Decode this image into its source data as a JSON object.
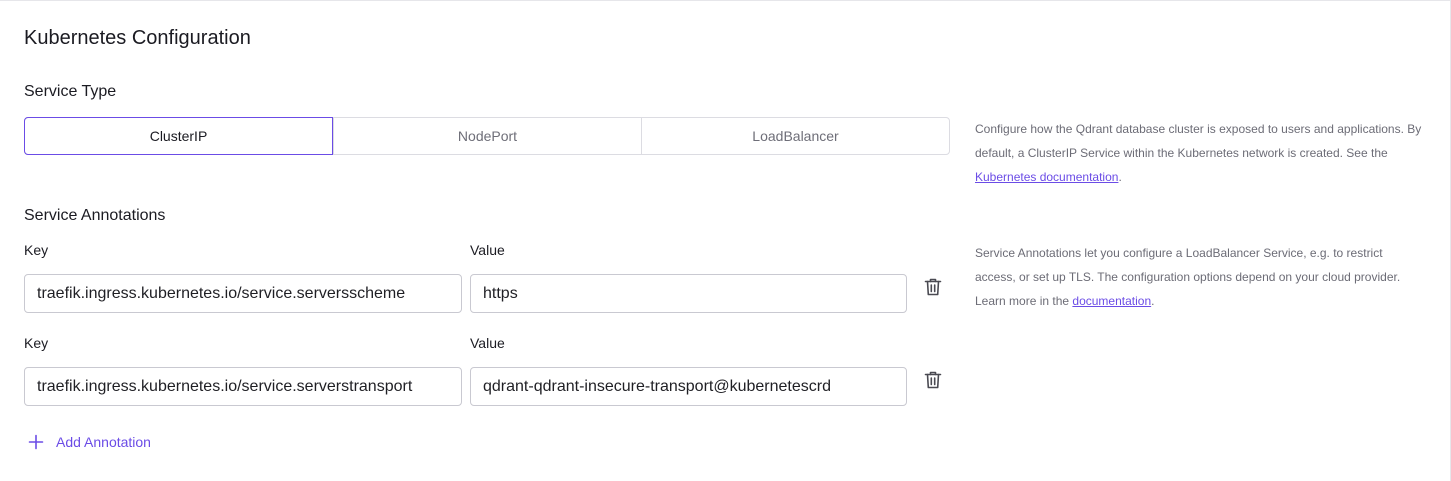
{
  "title": "Kubernetes Configuration",
  "service_type": {
    "label": "Service Type",
    "options": [
      {
        "label": "ClusterIP",
        "active": true
      },
      {
        "label": "NodePort",
        "active": false
      },
      {
        "label": "LoadBalancer",
        "active": false
      }
    ],
    "help": {
      "text_before": "Configure how the Qdrant database cluster is exposed to users and applications. By default, a ClusterIP Service within the Kubernetes network is created. See the ",
      "link": "Kubernetes documentation",
      "text_after": "."
    }
  },
  "annotations": {
    "label": "Service Annotations",
    "rows": [
      {
        "key_label": "Key",
        "value_label": "Value",
        "key": "traefik.ingress.kubernetes.io/service.serversscheme",
        "value": "https"
      },
      {
        "key_label": "Key",
        "value_label": "Value",
        "key": "traefik.ingress.kubernetes.io/service.serverstransport",
        "value": "qdrant-qdrant-insecure-transport@kubernetescrd"
      }
    ],
    "add_label": "Add Annotation",
    "help": {
      "text_before": "Service Annotations let you configure a LoadBalancer Service, e.g. to restrict access, or set up TLS. The configuration options depend on your cloud provider. Learn more in the ",
      "link": "documentation",
      "text_after": "."
    }
  },
  "colors": {
    "accent": "#6b4ce6",
    "border": "#c9c9d1",
    "muted_text": "#6c6c76"
  },
  "icons": {
    "delete": "trash-icon",
    "add": "plus-icon"
  }
}
